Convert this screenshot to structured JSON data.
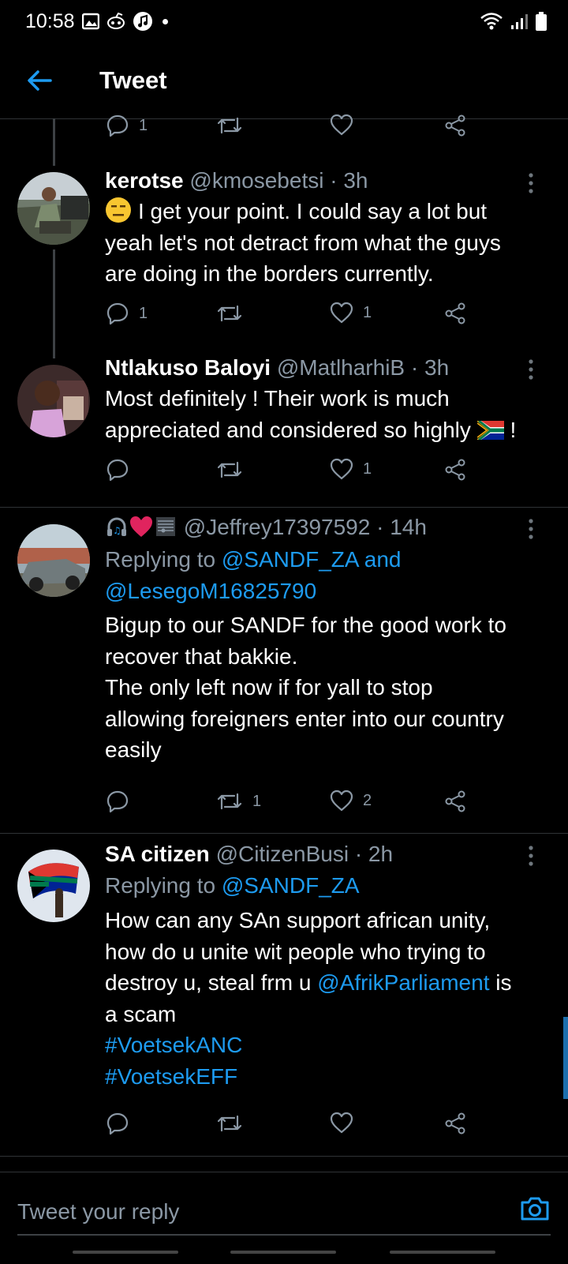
{
  "status_bar": {
    "time": "10:58"
  },
  "header": {
    "title": "Tweet"
  },
  "top_actions": {
    "reply_count": "1"
  },
  "tweets": [
    {
      "name": "kerotse",
      "handle": "@kmosebetsi",
      "time": "· 3h",
      "text_line1": "I get your point. I could say a lot but",
      "text_line2": "yeah let's not detract from what the guys",
      "text_line3": "are doing in the borders currently.",
      "reply_count": "1",
      "retweet_count": "",
      "like_count": "1"
    },
    {
      "name": "Ntlakuso Baloyi",
      "handle": "@MatlharhiB",
      "time": "· 3h",
      "text_line1": "Most definitely ! Their work is much",
      "text_line2": "appreciated and considered so highly",
      "text_tail": "!",
      "reply_count": "",
      "retweet_count": "",
      "like_count": "1"
    },
    {
      "handle": "@Jeffrey17397592",
      "time": "· 14h",
      "replying_prefix": "Replying to",
      "replying_to": "@SANDF_ZA and",
      "replying_to2": "@LesegoM16825790",
      "text_line1": "Bigup to our SANDF for the good work to",
      "text_line2": "recover that bakkie.",
      "text_line3": "The only left now if for yall to stop",
      "text_line4": "allowing foreigners enter into our country",
      "text_line5": "easily",
      "reply_count": "",
      "retweet_count": "1",
      "like_count": "2"
    },
    {
      "name": "SA citizen",
      "handle": "@CitizenBusi",
      "time": "· 2h",
      "replying_prefix": "Replying to",
      "replying_to": "@SANDF_ZA",
      "text_line1": "How can any SAn support african unity,",
      "text_line2": "how do u unite wit people who trying to",
      "text_line3_a": "destroy u, steal frm u",
      "text_line3_mention": "@AfrikParliament",
      "text_line3_b": "is",
      "text_line4": "a scam",
      "hashtag1": "#VoetsekANC",
      "hashtag2": "#VoetsekEFF",
      "reply_count": "",
      "retweet_count": "",
      "like_count": ""
    }
  ],
  "reply_box": {
    "placeholder": "Tweet your reply"
  },
  "colors": {
    "accent": "#1d9bf0",
    "muted": "#8b98a5",
    "background": "#000000",
    "heart": "#e0245e"
  },
  "icons": [
    "back-arrow-icon",
    "reply-icon",
    "retweet-icon",
    "like-icon",
    "share-icon",
    "more-icon",
    "camera-icon",
    "wifi-icon",
    "signal-icon",
    "battery-icon",
    "gallery-icon",
    "music-icon"
  ]
}
